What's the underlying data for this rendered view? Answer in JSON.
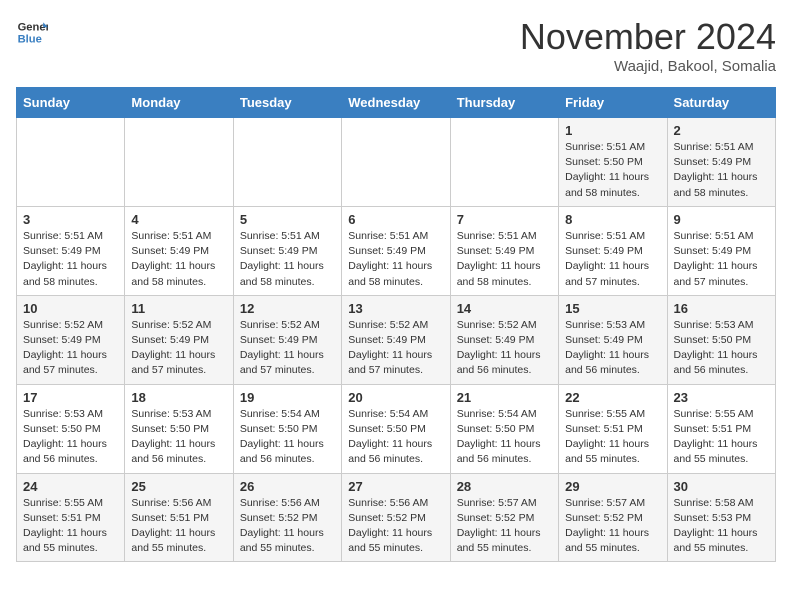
{
  "header": {
    "logo_line1": "General",
    "logo_line2": "Blue",
    "month_title": "November 2024",
    "subtitle": "Waajid, Bakool, Somalia"
  },
  "weekdays": [
    "Sunday",
    "Monday",
    "Tuesday",
    "Wednesday",
    "Thursday",
    "Friday",
    "Saturday"
  ],
  "weeks": [
    [
      {
        "day": "",
        "info": ""
      },
      {
        "day": "",
        "info": ""
      },
      {
        "day": "",
        "info": ""
      },
      {
        "day": "",
        "info": ""
      },
      {
        "day": "",
        "info": ""
      },
      {
        "day": "1",
        "info": "Sunrise: 5:51 AM\nSunset: 5:50 PM\nDaylight: 11 hours and 58 minutes."
      },
      {
        "day": "2",
        "info": "Sunrise: 5:51 AM\nSunset: 5:49 PM\nDaylight: 11 hours and 58 minutes."
      }
    ],
    [
      {
        "day": "3",
        "info": "Sunrise: 5:51 AM\nSunset: 5:49 PM\nDaylight: 11 hours and 58 minutes."
      },
      {
        "day": "4",
        "info": "Sunrise: 5:51 AM\nSunset: 5:49 PM\nDaylight: 11 hours and 58 minutes."
      },
      {
        "day": "5",
        "info": "Sunrise: 5:51 AM\nSunset: 5:49 PM\nDaylight: 11 hours and 58 minutes."
      },
      {
        "day": "6",
        "info": "Sunrise: 5:51 AM\nSunset: 5:49 PM\nDaylight: 11 hours and 58 minutes."
      },
      {
        "day": "7",
        "info": "Sunrise: 5:51 AM\nSunset: 5:49 PM\nDaylight: 11 hours and 58 minutes."
      },
      {
        "day": "8",
        "info": "Sunrise: 5:51 AM\nSunset: 5:49 PM\nDaylight: 11 hours and 57 minutes."
      },
      {
        "day": "9",
        "info": "Sunrise: 5:51 AM\nSunset: 5:49 PM\nDaylight: 11 hours and 57 minutes."
      }
    ],
    [
      {
        "day": "10",
        "info": "Sunrise: 5:52 AM\nSunset: 5:49 PM\nDaylight: 11 hours and 57 minutes."
      },
      {
        "day": "11",
        "info": "Sunrise: 5:52 AM\nSunset: 5:49 PM\nDaylight: 11 hours and 57 minutes."
      },
      {
        "day": "12",
        "info": "Sunrise: 5:52 AM\nSunset: 5:49 PM\nDaylight: 11 hours and 57 minutes."
      },
      {
        "day": "13",
        "info": "Sunrise: 5:52 AM\nSunset: 5:49 PM\nDaylight: 11 hours and 57 minutes."
      },
      {
        "day": "14",
        "info": "Sunrise: 5:52 AM\nSunset: 5:49 PM\nDaylight: 11 hours and 56 minutes."
      },
      {
        "day": "15",
        "info": "Sunrise: 5:53 AM\nSunset: 5:49 PM\nDaylight: 11 hours and 56 minutes."
      },
      {
        "day": "16",
        "info": "Sunrise: 5:53 AM\nSunset: 5:50 PM\nDaylight: 11 hours and 56 minutes."
      }
    ],
    [
      {
        "day": "17",
        "info": "Sunrise: 5:53 AM\nSunset: 5:50 PM\nDaylight: 11 hours and 56 minutes."
      },
      {
        "day": "18",
        "info": "Sunrise: 5:53 AM\nSunset: 5:50 PM\nDaylight: 11 hours and 56 minutes."
      },
      {
        "day": "19",
        "info": "Sunrise: 5:54 AM\nSunset: 5:50 PM\nDaylight: 11 hours and 56 minutes."
      },
      {
        "day": "20",
        "info": "Sunrise: 5:54 AM\nSunset: 5:50 PM\nDaylight: 11 hours and 56 minutes."
      },
      {
        "day": "21",
        "info": "Sunrise: 5:54 AM\nSunset: 5:50 PM\nDaylight: 11 hours and 56 minutes."
      },
      {
        "day": "22",
        "info": "Sunrise: 5:55 AM\nSunset: 5:51 PM\nDaylight: 11 hours and 55 minutes."
      },
      {
        "day": "23",
        "info": "Sunrise: 5:55 AM\nSunset: 5:51 PM\nDaylight: 11 hours and 55 minutes."
      }
    ],
    [
      {
        "day": "24",
        "info": "Sunrise: 5:55 AM\nSunset: 5:51 PM\nDaylight: 11 hours and 55 minutes."
      },
      {
        "day": "25",
        "info": "Sunrise: 5:56 AM\nSunset: 5:51 PM\nDaylight: 11 hours and 55 minutes."
      },
      {
        "day": "26",
        "info": "Sunrise: 5:56 AM\nSunset: 5:52 PM\nDaylight: 11 hours and 55 minutes."
      },
      {
        "day": "27",
        "info": "Sunrise: 5:56 AM\nSunset: 5:52 PM\nDaylight: 11 hours and 55 minutes."
      },
      {
        "day": "28",
        "info": "Sunrise: 5:57 AM\nSunset: 5:52 PM\nDaylight: 11 hours and 55 minutes."
      },
      {
        "day": "29",
        "info": "Sunrise: 5:57 AM\nSunset: 5:52 PM\nDaylight: 11 hours and 55 minutes."
      },
      {
        "day": "30",
        "info": "Sunrise: 5:58 AM\nSunset: 5:53 PM\nDaylight: 11 hours and 55 minutes."
      }
    ]
  ]
}
